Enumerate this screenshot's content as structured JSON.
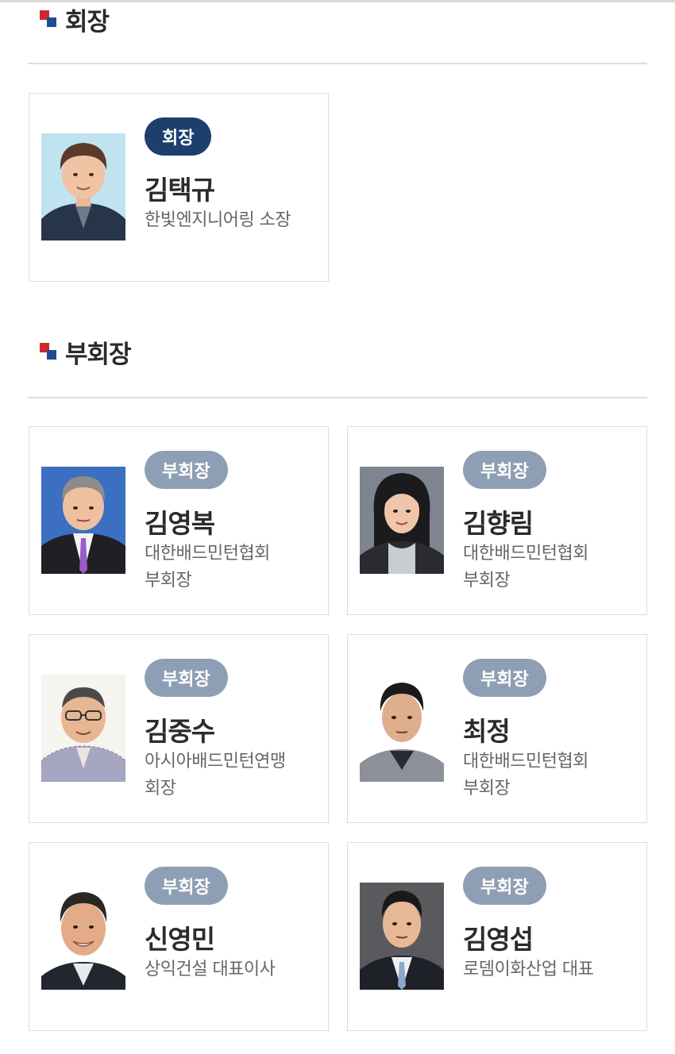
{
  "sections": [
    {
      "title": "회장"
    },
    {
      "title": "부회장"
    }
  ],
  "members": [
    {
      "role": "회장",
      "name": "김택규",
      "org_line1": "한빛엔지니어링 소장",
      "org_line2": ""
    },
    {
      "role": "부회장",
      "name": "김영복",
      "org_line1": "대한배드민턴협회",
      "org_line2": "부회장"
    },
    {
      "role": "부회장",
      "name": "김향림",
      "org_line1": "대한배드민턴협회",
      "org_line2": "부회장"
    },
    {
      "role": "부회장",
      "name": "김중수",
      "org_line1": "아시아배드민턴연맹",
      "org_line2": "회장"
    },
    {
      "role": "부회장",
      "name": "최정",
      "org_line1": "대한배드민턴협회",
      "org_line2": "부회장"
    },
    {
      "role": "부회장",
      "name": "신영민",
      "org_line1": "상익건설 대표이사",
      "org_line2": ""
    },
    {
      "role": "부회장",
      "name": "김영섭",
      "org_line1": "로뎀이화산업 대표",
      "org_line2": ""
    }
  ],
  "colors": {
    "president_badge": "#1c3f6e",
    "vice_badge": "#8e9fb5",
    "mark_red": "#d0262f",
    "mark_blue": "#1e4d93"
  }
}
